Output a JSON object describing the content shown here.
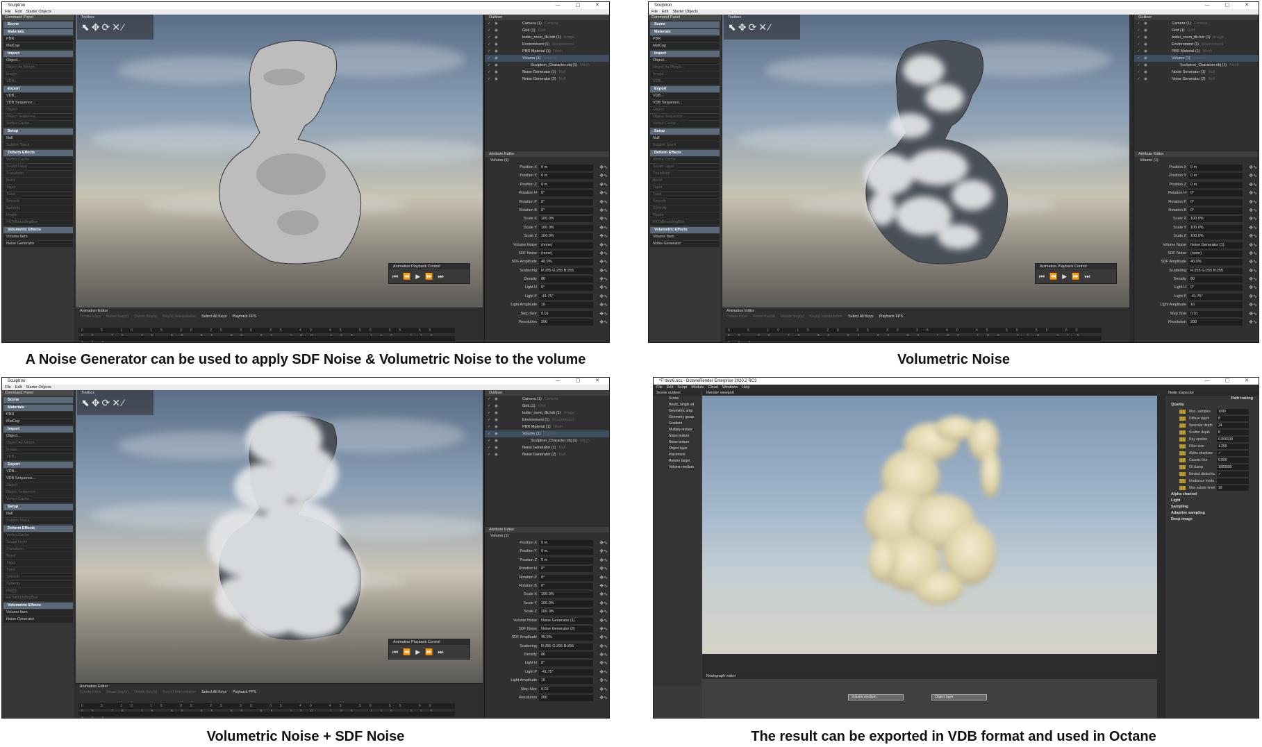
{
  "captions": {
    "panel1": "A Noise Generator can be used to apply SDF Noise & Volumetric Noise to the volume",
    "panel2": "Volumetric Noise",
    "panel3": "Volumetric Noise + SDF Noise",
    "panel4": "The result can be exported in VDB format and used in Octane"
  },
  "sculptron": {
    "app_title": "Sculptron",
    "window_controls": "— ▢ ✕",
    "menu": [
      "File",
      "Edit",
      "Starter Objects"
    ],
    "command_panel": {
      "title": "Command Panel",
      "sections": {
        "scene": "Scene",
        "materials": "Materials",
        "import": "Import",
        "export": "Export",
        "setup": "Setup",
        "deform": "Deform Effects",
        "volumetric": "Volumetric Effects"
      },
      "materials_items": [
        "PBR",
        "MatCap"
      ],
      "import_items": [
        "Object...",
        "Object As Morph...",
        "Image...",
        "VDB..."
      ],
      "export_items": [
        "VDB...",
        "VDB Sequence...",
        "Object",
        "Object Sequence...",
        "Vertex Cache..."
      ],
      "setup_items": [
        "Null",
        "Sublink Stack"
      ],
      "deform_items": [
        "Vertex Cache",
        "Sculpt Layer",
        "Transform",
        "Bend",
        "Taper",
        "Twist",
        "Smooth",
        "Spherify",
        "Ripple",
        "FKToBoundingBox"
      ],
      "volumetric_items": [
        "Volume Item",
        "Noise Generator"
      ]
    },
    "toolbox_title": "Toolbox",
    "playback_title": "Animation Playback Control",
    "animation_editor": {
      "title": "Animation Editor",
      "buttons": [
        "Create Keys",
        "Reset Key(s)",
        "Delete Key(s)",
        "Key(s) Interpolation",
        "Select All Keys",
        "Playback FPS"
      ],
      "ticks": "0 5 10 15 20 25 30 35 40 45 50 55 60 65 70 75 80 85 90 95 100 105 110 115 120",
      "end_frame": "120"
    },
    "outliner": {
      "title": "Outliner",
      "rows": [
        {
          "label": "Camera (1)",
          "type": "Camera"
        },
        {
          "label": "Grid (1)",
          "type": "Grid"
        },
        {
          "label": "boiler_room_8k.hdr (1)",
          "type": "Image"
        },
        {
          "label": "Environment (1)",
          "type": "Environment"
        },
        {
          "label": "PBR Material (1)",
          "type": "Mesh"
        },
        {
          "label": "Volume (1)",
          "type": "Volume"
        },
        {
          "label": "Sculptron_Character.obj (1)",
          "type": "Mesh"
        },
        {
          "label": "Noise Generator (1)",
          "type": "Null"
        },
        {
          "label": "Noise Generator (2)",
          "type": "Null"
        }
      ]
    },
    "attribute_editor": {
      "title": "Attribute Editor",
      "object": "Volume (1)",
      "labels": [
        "Position X",
        "Position Y",
        "Position Z",
        "Rotation H",
        "Rotation P",
        "Rotation B",
        "Scale X",
        "Scale Y",
        "Scale Z",
        "Volume Noise",
        "SDF Noise",
        "SDF Amplitude",
        "Scattering",
        "Density",
        "Light H",
        "Light P",
        "Light Amplitude",
        "Step Size",
        "Resolution"
      ]
    },
    "panel_values": {
      "p1": [
        "0 m",
        "0 m",
        "0 m",
        "0°",
        "0°",
        "0°",
        "100.0%",
        "100.0%",
        "100.0%",
        "(none)",
        "(none)",
        "40.0%",
        "R:255  G:255  B:255",
        "80",
        "0°",
        "-41.75°",
        "16",
        "0.01",
        "200"
      ],
      "p2": [
        "0 m",
        "0 m",
        "0 m",
        "0°",
        "0°",
        "0°",
        "100.0%",
        "100.0%",
        "100.0%",
        "Noise Generator (1)",
        "(none)",
        "40.0%",
        "R:255  G:255  B:255",
        "80",
        "0°",
        "-41.75°",
        "16",
        "0.01",
        "200"
      ],
      "p3": [
        "0 m",
        "0 m",
        "0 m",
        "0°",
        "0°",
        "0°",
        "100.0%",
        "100.0%",
        "100.0%",
        "Noise Generator (1)",
        "Noise Generator (2)",
        "40.0%",
        "R:255  G:255  B:255",
        "80",
        "0°",
        "-41.75°",
        "16",
        "0.01",
        "200"
      ]
    }
  },
  "octane": {
    "app_title": "*F:\\test6.ocs - OctaneRender Enterprise 2020.2 RC3",
    "menu": [
      "File",
      "Edit",
      "Script",
      "Module",
      "Cloud",
      "Windows",
      "Help"
    ],
    "scene_outliner_title": "Scene outliner",
    "scene_items": [
      "Scene",
      "Beast_Single.vd",
      "Geometric amp",
      "Geometry group",
      "Gradient",
      "Multiply texture",
      "Noise texture",
      "Noise texture",
      "Object layer",
      "Placement",
      "Render target",
      "Volume medium"
    ],
    "render_viewport_title": "Render viewport",
    "nodegraph_title": "Nodegraph editor",
    "nodes": [
      "Volume medium",
      "Object layer"
    ],
    "node_inspector_title": "Node inspector",
    "kernel": "Path tracing",
    "inspector_sections": [
      "Quality",
      "Alpha channel",
      "Light",
      "Sampling",
      "Adaptive sampling",
      "Deep image"
    ],
    "quality_items": [
      {
        "label": "Max. samples",
        "value": "1000"
      },
      {
        "label": "Diffuse depth",
        "value": "8"
      },
      {
        "label": "Specular depth",
        "value": "24"
      },
      {
        "label": "Scatter depth",
        "value": "8"
      },
      {
        "label": "Ray epsilon",
        "value": "0.000100"
      },
      {
        "label": "Filter size",
        "value": "1.200"
      },
      {
        "label": "Alpha shadows",
        "value": "✓"
      },
      {
        "label": "Caustic blur",
        "value": "0.000"
      },
      {
        "label": "GI clamp",
        "value": "1000000"
      },
      {
        "label": "Nested dielectric",
        "value": "✓"
      },
      {
        "label": "Irradiance mode",
        "value": ""
      },
      {
        "label": "Max subdiv level",
        "value": "10"
      }
    ]
  }
}
